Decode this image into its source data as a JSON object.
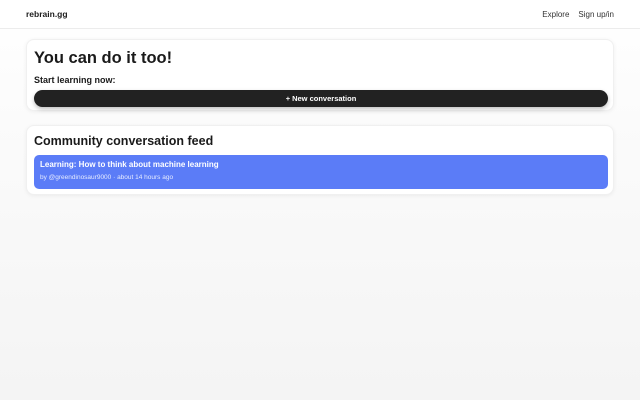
{
  "header": {
    "brand": "rebrain.gg",
    "nav": [
      {
        "label": "Explore"
      },
      {
        "label": "Sign up/in"
      }
    ]
  },
  "hero": {
    "title": "You can do it too!",
    "subtitle": "Start learning now:",
    "new_button_icon": "+",
    "new_button_label": "New conversation"
  },
  "feed": {
    "title": "Community conversation feed",
    "items": [
      {
        "title": "Learning: How to think about machine learning",
        "meta": "by @greendinosaur9000 · about 14 hours ago"
      }
    ]
  },
  "colors": {
    "accent": "#5b7cf7",
    "button_dark": "#222222"
  }
}
